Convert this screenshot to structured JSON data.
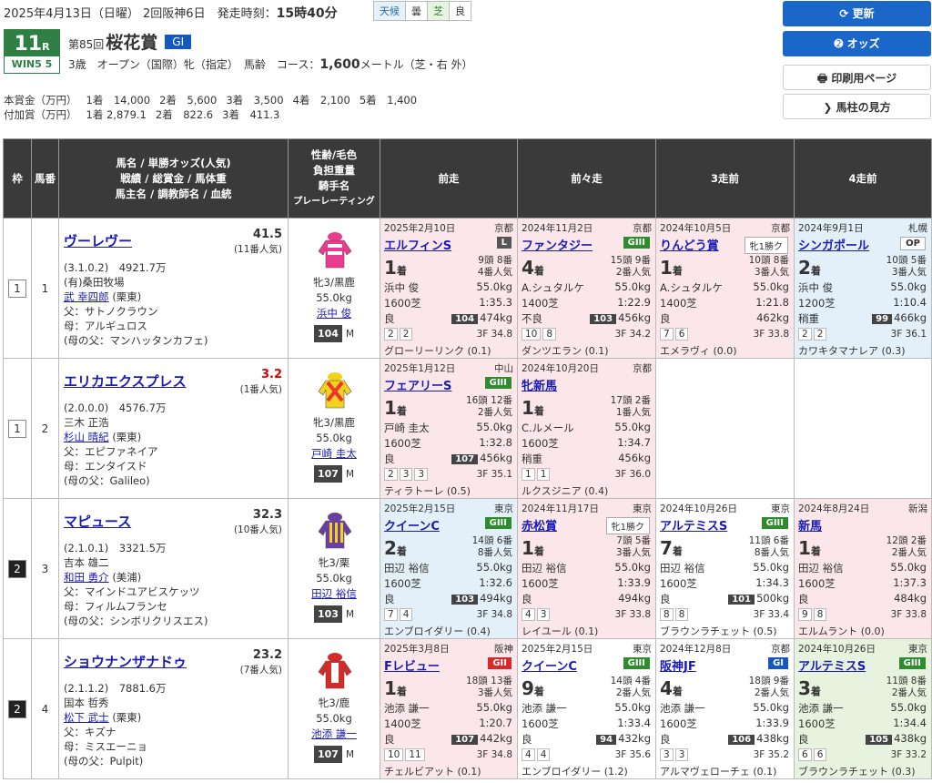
{
  "header": {
    "date": "2025年4月13日（日曜） 2回阪神6日",
    "start_label": "発走時刻：",
    "start_time": "15時40分",
    "weather_label": "天候",
    "weather": "曇",
    "track_label": "芝",
    "track_cond": "良",
    "race_no": "11",
    "race_no_suffix": "R",
    "win5": "WIN5 5",
    "kai": "第85回",
    "race_name": "桜花賞",
    "grade": "GI",
    "conditions": "3歳　オープン（国際）牝（指定）　馬齢　コース：",
    "distance": "1,600",
    "distance_unit": "メートル（芝・右 外）",
    "prize_main": [
      "本賞金（万円）",
      "1着　14,000",
      "2着　5,600",
      "3着　3,500",
      "4着　2,100",
      "5着　1,400"
    ],
    "prize_add": [
      "付加賞（万円）",
      "1着 2,879.1",
      "2着　822.6",
      "3着　411.3"
    ]
  },
  "buttons": {
    "refresh": "⟳ 更新",
    "odds": "➋ オッズ",
    "print": "🖶 印刷用ページ",
    "guide": "❯ 馬柱の見方"
  },
  "columns": {
    "waku": "枠",
    "umaban": "馬番",
    "horse": [
      "馬名 / 単勝オッズ(人気)",
      "戦績 / 総賞金 / 馬体重",
      "馬主名 / 調教師名 / 血統"
    ],
    "jockey": [
      "性齢/毛色",
      "負担重量",
      "騎手名",
      "プレーレーティング"
    ],
    "p1": "前走",
    "p2": "前々走",
    "p3": "3走前",
    "p4": "4走前"
  },
  "horses": [
    {
      "waku": "1",
      "umaban": "1",
      "name": "ヴーレヴー",
      "odds": "41.5",
      "ninki": "(11番人気)",
      "record": "(3.1.0.2)　4921.7万",
      "owner": "(有)桑田牧場",
      "trainer": "武 幸四郎",
      "trainer_loc": "(栗東)",
      "sire": "父：サトノクラウン",
      "dam": "母：アルギュロス",
      "damsire": "(母の父：マンハッタンカフェ)",
      "sex": "牝3/黒鹿",
      "weight": "55.0kg",
      "jockey": "浜中 俊",
      "rating": "104",
      "rating_m": "M",
      "silk": "pink",
      "past": [
        {
          "bg": "pink",
          "date": "2025年2月10日",
          "venue": "京都",
          "race": "エルフィンS",
          "grade": "L",
          "gcls": "g-l",
          "rank": "1",
          "heads": "9頭 8番",
          "pop": "4番人気",
          "jockey": "浜中 俊",
          "wt": "55.0kg",
          "dist": "1600芝",
          "time": "1:35.3",
          "cond": "良",
          "pr": "104",
          "bw": "474kg",
          "pos": [
            "2",
            "2"
          ],
          "f3": "3F 34.8",
          "win": "グローリーリンク (0.1)"
        },
        {
          "bg": "pink",
          "date": "2024年11月2日",
          "venue": "京都",
          "race": "ファンタジー",
          "grade": "GIII",
          "gcls": "g-g3",
          "rank": "4",
          "heads": "15頭 9番",
          "pop": "2番人気",
          "jockey": "A.シュタルケ",
          "wt": "55.0kg",
          "dist": "1400芝",
          "time": "1:22.9",
          "cond": "不良",
          "pr": "103",
          "bw": "456kg",
          "pos": [
            "10",
            "8"
          ],
          "f3": "3F 34.2",
          "win": "ダンツエラン (0.1)"
        },
        {
          "bg": "pink",
          "date": "2024年10月5日",
          "venue": "京都",
          "race": "りんどう賞",
          "grade": "牝1勝ク",
          "gcls": "g-txt",
          "rank": "1",
          "heads": "10頭 8番",
          "pop": "3番人気",
          "jockey": "A.シュタルケ",
          "wt": "55.0kg",
          "dist": "1400芝",
          "time": "1:21.8",
          "cond": "良",
          "pr": "",
          "bw": "462kg",
          "pos": [
            "7",
            "6"
          ],
          "f3": "3F 33.8",
          "win": "エメラヴィ (0.0)"
        },
        {
          "bg": "blue",
          "date": "2024年9月1日",
          "venue": "札幌",
          "race": "シンガポール",
          "grade": "OP",
          "gcls": "g-op",
          "rank": "2",
          "heads": "10頭 5番",
          "pop": "3番人気",
          "jockey": "浜中 俊",
          "wt": "55.0kg",
          "dist": "1200芝",
          "time": "1:10.4",
          "cond": "稍重",
          "pr": "99",
          "bw": "466kg",
          "pos": [
            "2",
            "2"
          ],
          "f3": "3F 36.1",
          "win": "カワキタマナレア (0.3)"
        }
      ]
    },
    {
      "waku": "1",
      "umaban": "2",
      "name": "エリカエクスプレス",
      "odds": "3.2",
      "ninki": "(1番人気)",
      "record": "(2.0.0.0)　4576.7万",
      "owner": "三木 正浩",
      "trainer": "杉山 晴紀",
      "trainer_loc": "(栗東)",
      "sire": "父：エピファネイア",
      "dam": "母：エンタイスド",
      "damsire": "(母の父：Galileo)",
      "sex": "牝3/黒鹿",
      "weight": "55.0kg",
      "jockey": "戸崎 圭太",
      "rating": "107",
      "rating_m": "M",
      "silk": "yellow",
      "past": [
        {
          "bg": "pink",
          "date": "2025年1月12日",
          "venue": "中山",
          "race": "フェアリーS",
          "grade": "GIII",
          "gcls": "g-g3",
          "rank": "1",
          "heads": "16頭 12番",
          "pop": "2番人気",
          "jockey": "戸崎 圭太",
          "wt": "55.0kg",
          "dist": "1600芝",
          "time": "1:32.8",
          "cond": "良",
          "pr": "107",
          "bw": "456kg",
          "pos": [
            "2",
            "3",
            "3"
          ],
          "f3": "3F 35.1",
          "win": "ティラトーレ (0.5)"
        },
        {
          "bg": "pink",
          "date": "2024年10月20日",
          "venue": "京都",
          "race": "牝新馬",
          "grade": "",
          "gcls": "",
          "rank": "1",
          "heads": "17頭 2番",
          "pop": "1番人気",
          "jockey": "C.ルメール",
          "wt": "55.0kg",
          "dist": "1600芝",
          "time": "1:34.7",
          "cond": "稍重",
          "pr": "",
          "bw": "456kg",
          "pos": [
            "1",
            "1"
          ],
          "f3": "3F 36.0",
          "win": "ルクスジニア (0.4)"
        },
        null,
        null
      ]
    },
    {
      "waku": "2",
      "umaban": "3",
      "name": "マピュース",
      "odds": "32.3",
      "ninki": "(10番人気)",
      "record": "(2.1.0.1)　3321.5万",
      "owner": "吉本 雄二",
      "trainer": "和田 勇介",
      "trainer_loc": "(美浦)",
      "sire": "父：マインドユアビスケッツ",
      "dam": "母：フィルムフランセ",
      "damsire": "(母の父：シンボリクリスエス)",
      "sex": "牝3/栗",
      "weight": "55.0kg",
      "jockey": "田辺 裕信",
      "rating": "103",
      "rating_m": "M",
      "silk": "purple",
      "past": [
        {
          "bg": "blue",
          "date": "2025年2月15日",
          "venue": "東京",
          "race": "クイーンC",
          "grade": "GIII",
          "gcls": "g-g3",
          "rank": "2",
          "heads": "14頭 6番",
          "pop": "8番人気",
          "jockey": "田辺 裕信",
          "wt": "55.0kg",
          "dist": "1600芝",
          "time": "1:32.6",
          "cond": "良",
          "pr": "103",
          "bw": "494kg",
          "pos": [
            "7",
            "4"
          ],
          "f3": "3F 34.8",
          "win": "エンブロイダリー (0.4)"
        },
        {
          "bg": "pink",
          "date": "2024年11月17日",
          "venue": "東京",
          "race": "赤松賞",
          "grade": "牝1勝ク",
          "gcls": "g-txt",
          "rank": "1",
          "heads": "7頭 5番",
          "pop": "3番人気",
          "jockey": "田辺 裕信",
          "wt": "55.0kg",
          "dist": "1600芝",
          "time": "1:33.9",
          "cond": "良",
          "pr": "",
          "bw": "494kg",
          "pos": [
            "4",
            "3"
          ],
          "f3": "3F 33.8",
          "win": "レイユール (0.1)"
        },
        {
          "bg": "white",
          "date": "2024年10月26日",
          "venue": "東京",
          "race": "アルテミスS",
          "grade": "GIII",
          "gcls": "g-g3",
          "rank": "7",
          "heads": "11頭 6番",
          "pop": "8番人気",
          "jockey": "田辺 裕信",
          "wt": "55.0kg",
          "dist": "1600芝",
          "time": "1:34.3",
          "cond": "良",
          "pr": "101",
          "bw": "500kg",
          "pos": [
            "8",
            "8"
          ],
          "f3": "3F 33.4",
          "win": "ブラウンラチェット (0.5)"
        },
        {
          "bg": "pink",
          "date": "2024年8月24日",
          "venue": "新潟",
          "race": "新馬",
          "grade": "",
          "gcls": "",
          "rank": "1",
          "heads": "12頭 2番",
          "pop": "2番人気",
          "jockey": "田辺 裕信",
          "wt": "55.0kg",
          "dist": "1600芝",
          "time": "1:37.3",
          "cond": "良",
          "pr": "",
          "bw": "484kg",
          "pos": [
            "9",
            "8"
          ],
          "f3": "3F 33.8",
          "win": "エルムラント (0.0)"
        }
      ]
    },
    {
      "waku": "2",
      "umaban": "4",
      "name": "ショウナンザナドゥ",
      "odds": "23.2",
      "ninki": "(7番人気)",
      "record": "(2.1.1.2)　7881.6万",
      "owner": "国本 哲秀",
      "trainer": "松下 武士",
      "trainer_loc": "(栗東)",
      "sire": "父：キズナ",
      "dam": "母：ミスエーニョ",
      "damsire": "(母の父：Pulpit)",
      "sex": "牝3/鹿",
      "weight": "55.0kg",
      "jockey": "池添 謙一",
      "rating": "107",
      "rating_m": "M",
      "silk": "red",
      "past": [
        {
          "bg": "pink",
          "date": "2025年3月8日",
          "venue": "阪神",
          "race": "Fレビュー",
          "grade": "GII",
          "gcls": "g-g2",
          "rank": "1",
          "heads": "18頭 13番",
          "pop": "3番人気",
          "jockey": "池添 謙一",
          "wt": "55.0kg",
          "dist": "1400芝",
          "time": "1:20.7",
          "cond": "良",
          "pr": "107",
          "bw": "442kg",
          "pos": [
            "10",
            "11"
          ],
          "f3": "3F 34.8",
          "win": "チェルビアット (0.1)"
        },
        {
          "bg": "white",
          "date": "2025年2月15日",
          "venue": "東京",
          "race": "クイーンC",
          "grade": "GIII",
          "gcls": "g-g3",
          "rank": "9",
          "heads": "14頭 4番",
          "pop": "2番人気",
          "jockey": "池添 謙一",
          "wt": "55.0kg",
          "dist": "1600芝",
          "time": "1:33.4",
          "cond": "良",
          "pr": "94",
          "bw": "432kg",
          "pos": [
            "4",
            "4"
          ],
          "f3": "3F 35.6",
          "win": "エンブロイダリー (1.2)"
        },
        {
          "bg": "white",
          "date": "2024年12月8日",
          "venue": "京都",
          "race": "阪神JF",
          "grade": "GI",
          "gcls": "g-g1",
          "rank": "4",
          "heads": "18頭 9番",
          "pop": "2番人気",
          "jockey": "池添 謙一",
          "wt": "55.0kg",
          "dist": "1600芝",
          "time": "1:33.9",
          "cond": "良",
          "pr": "106",
          "bw": "438kg",
          "pos": [
            "3",
            "3"
          ],
          "f3": "3F 35.2",
          "win": "アルマヴェローチェ (0.1)"
        },
        {
          "bg": "green",
          "date": "2024年10月26日",
          "venue": "東京",
          "race": "アルテミスS",
          "grade": "GIII",
          "gcls": "g-g3",
          "rank": "3",
          "heads": "11頭 8番",
          "pop": "2番人気",
          "jockey": "池添 謙一",
          "wt": "55.0kg",
          "dist": "1600芝",
          "time": "1:34.4",
          "cond": "良",
          "pr": "105",
          "bw": "438kg",
          "pos": [
            "6",
            "6"
          ],
          "f3": "3F 33.2",
          "win": "ブラウンラチェット (0.3)"
        }
      ]
    }
  ]
}
